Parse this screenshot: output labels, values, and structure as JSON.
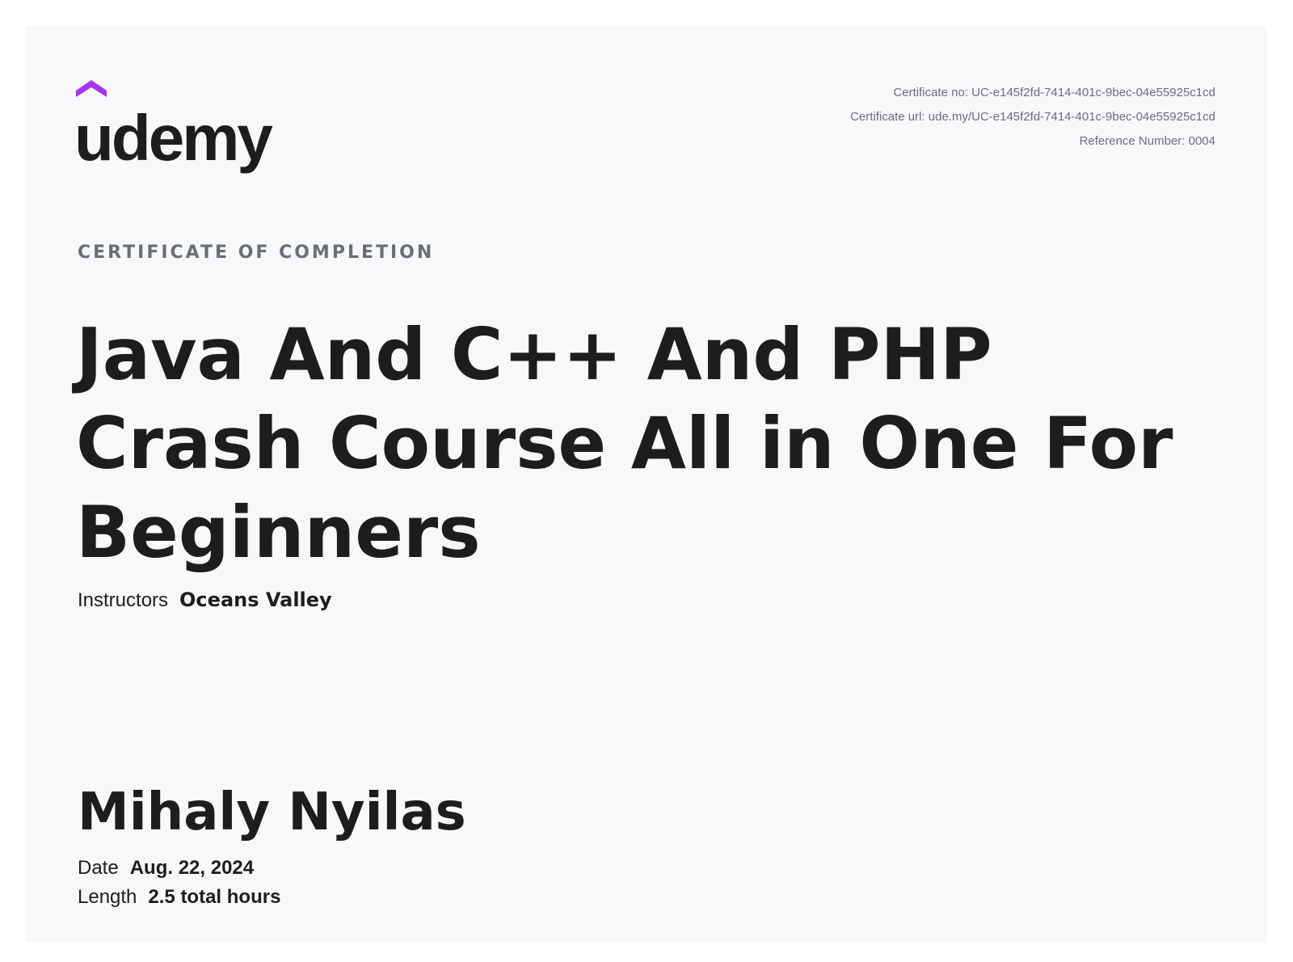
{
  "brand": {
    "logo_text": "udemy",
    "accent_color": "#a435f0",
    "icon": "udemy-logo-icon"
  },
  "meta": {
    "certificate_no": "Certificate no: UC-e145f2fd-7414-401c-9bec-04e55925c1cd",
    "certificate_url": "Certificate url: ude.my/UC-e145f2fd-7414-401c-9bec-04e55925c1cd",
    "reference_number": "Reference Number: 0004"
  },
  "certificate": {
    "eyebrow": "CERTIFICATE OF COMPLETION",
    "course_title": "Java And C++ And PHP Crash Course All in One For Beginners",
    "instructors_label": "Instructors",
    "instructors_value": "Oceans Valley",
    "recipient_name": "Mihaly Nyilas",
    "date_label": "Date",
    "date_value": "Aug. 22, 2024",
    "length_label": "Length",
    "length_value": "2.5 total hours"
  },
  "colors": {
    "background": "#f7f8fa",
    "text_primary": "#1c1d1f",
    "text_secondary": "#6a6f73"
  }
}
